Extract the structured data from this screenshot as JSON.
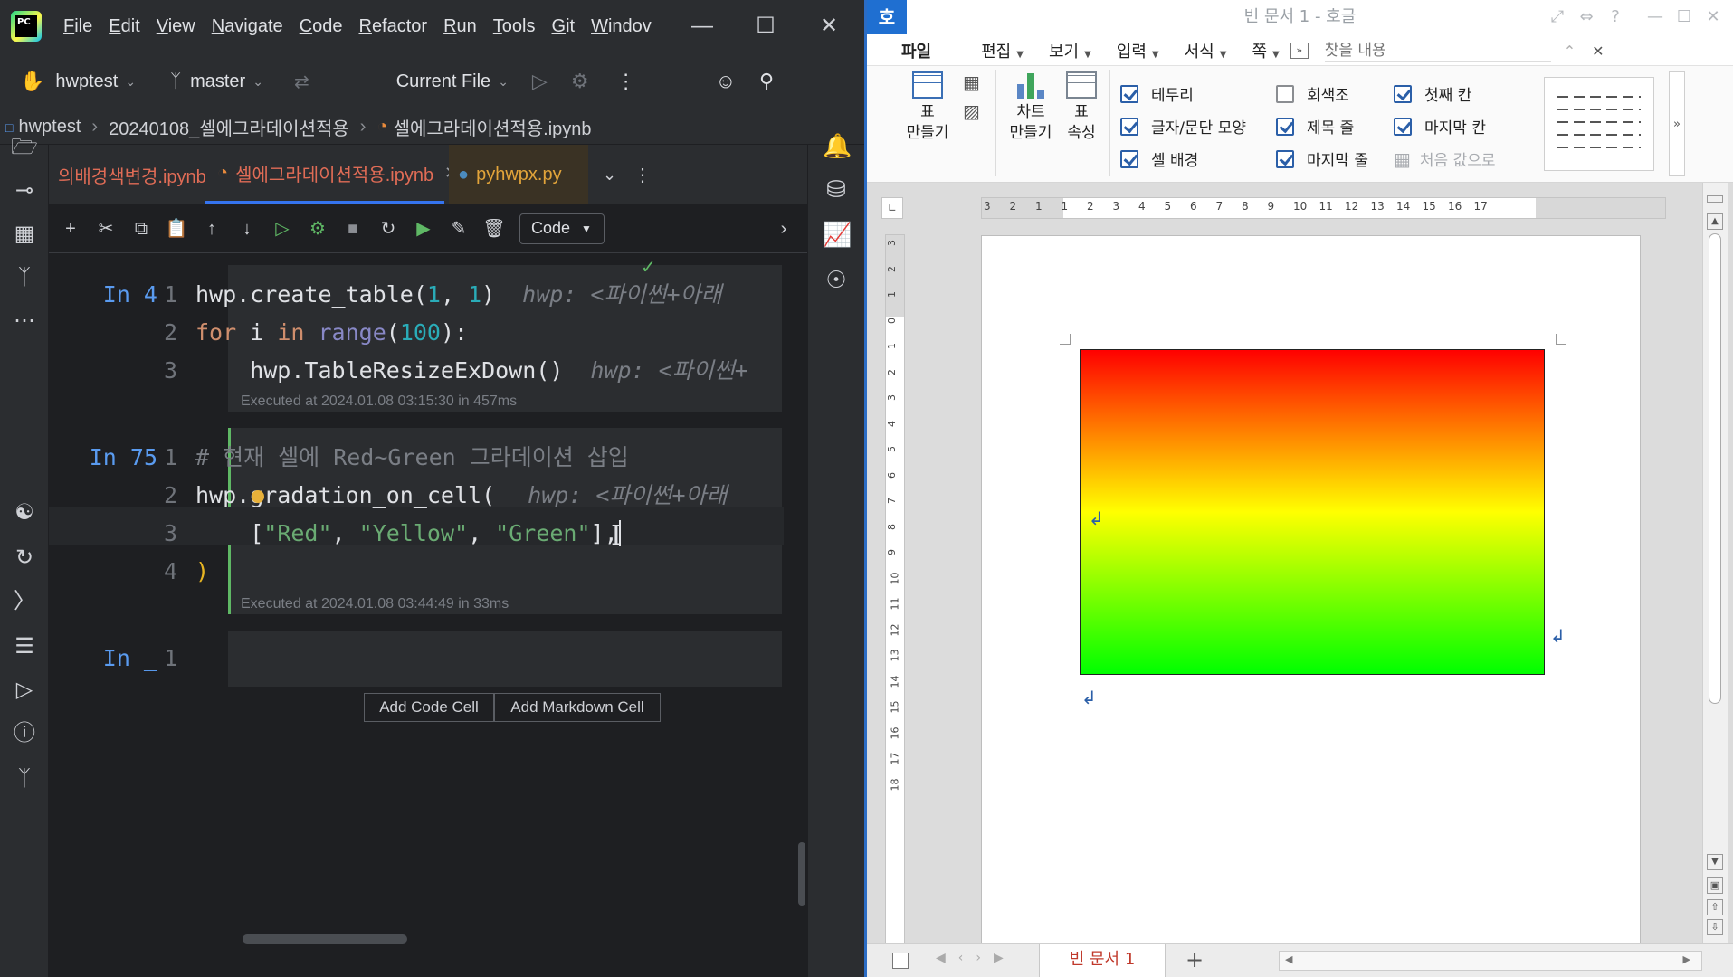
{
  "ide": {
    "menu": [
      {
        "label": "File",
        "mn": "F",
        "rest": "ile"
      },
      {
        "label": "Edit",
        "mn": "E",
        "rest": "dit"
      },
      {
        "label": "View",
        "mn": "V",
        "rest": "iew"
      },
      {
        "label": "Navigate",
        "mn": "N",
        "rest": "avigate"
      },
      {
        "label": "Code",
        "mn": "C",
        "rest": "ode"
      },
      {
        "label": "Refactor",
        "mn": "R",
        "rest": "efactor"
      },
      {
        "label": "Run",
        "mn": "R",
        "rest": "un"
      },
      {
        "label": "Tools",
        "mn": "T",
        "rest": "ools"
      },
      {
        "label": "Git",
        "mn": "G",
        "rest": "it"
      },
      {
        "label": "Window",
        "mn": "W",
        "rest": "indov"
      }
    ],
    "project": "hwptest",
    "branch": "master",
    "run_config": "Current File",
    "breadcrumb": [
      "hwptest",
      "20240108_셀에그라데이션적용",
      "셀에그라데이션적용.ipynb"
    ],
    "tabs": [
      {
        "label": "의배경색변경.ipynb"
      },
      {
        "label": "셀에그라데이션적용.ipynb",
        "active": true
      },
      {
        "label": "pyhwpx.py"
      }
    ],
    "cell_type": "Code",
    "cells": [
      {
        "prompt": "In 4",
        "lines": [
          "1",
          "2",
          "3"
        ],
        "code": {
          "l1a": "hwp.create_table(",
          "l1n1": "1",
          "l1c": ", ",
          "l1n2": "1",
          "l1b": ")",
          "l1hint": "hwp: <파이썬+아래",
          "l2kw": "for",
          "l2a": " i ",
          "l2in": "in",
          "l2b": " ",
          "l2rng": "range",
          "l2c": "(",
          "l2n": "100",
          "l2d": "):",
          "l3": "    hwp.TableResizeExDown()",
          "l3hint": "hwp: <파이썬+"
        },
        "executed": "Executed at 2024.01.08 03:15:30 in 457ms"
      },
      {
        "prompt": "In 75",
        "lines": [
          "1",
          "2",
          "3",
          "4"
        ],
        "code": {
          "l1": "# 현재 셀에 Red~Green 그라데이션 삽입",
          "l2": "hwp.gradation_on_cell(",
          "l2hint": "hwp: <파이썬+아래",
          "l3pre": "    [",
          "s1": "\"Red\"",
          "c1": ", ",
          "s2": "\"Yellow\"",
          "c2": ", ",
          "s3": "\"Green\"",
          "l3post": "],",
          "l4": ")"
        },
        "executed": "Executed at 2024.01.08 03:44:49 in 33ms"
      },
      {
        "prompt": "In _",
        "lines": [
          "1"
        ]
      }
    ],
    "add_code_cell": "Add Code Cell",
    "add_markdown_cell": "Add Markdown Cell",
    "colors": {
      "accent": "#3574f0",
      "keyword": "#cf8e6d",
      "string": "#6aab73",
      "number": "#2aacb8",
      "prompt": "#5a9bf0"
    }
  },
  "hwp": {
    "title": "빈 문서 1 - 호글",
    "logo": "호",
    "menu": [
      "파일",
      "편집",
      "보기",
      "입력",
      "서식",
      "쪽"
    ],
    "search_placeholder": "찾을 내용",
    "ribbon": {
      "table_make": "표\n만들기",
      "chart_make": "차트\n만들기",
      "table_props": "표\n속성",
      "checks": [
        {
          "label": "테두리",
          "checked": true
        },
        {
          "label": "글자/문단 모양",
          "checked": true
        },
        {
          "label": "셀 배경",
          "checked": true
        },
        {
          "label": "회색조",
          "checked": false
        },
        {
          "label": "제목 줄",
          "checked": true
        },
        {
          "label": "마지막 줄",
          "checked": true
        },
        {
          "label": "첫째 칸",
          "checked": true
        },
        {
          "label": "마지막 칸",
          "checked": true
        },
        {
          "label": "처음 값으로",
          "checked": false,
          "disabled": true
        }
      ]
    },
    "hruler_ticks": [
      "3",
      "2",
      "1",
      "1",
      "2",
      "3",
      "4",
      "5",
      "6",
      "7",
      "8",
      "9",
      "10",
      "11",
      "12",
      "13",
      "14",
      "15",
      "16",
      "17"
    ],
    "vruler_ticks": [
      "3",
      "2",
      "1",
      "0",
      "1",
      "2",
      "3",
      "4",
      "5",
      "6",
      "7",
      "8",
      "9",
      "10",
      "11",
      "12",
      "13",
      "14",
      "15",
      "16",
      "17",
      "18"
    ],
    "gradient": {
      "colors": [
        "#ff0000",
        "#ffff00",
        "#00ff00"
      ]
    },
    "doc_tab": "빈 문서 1",
    "add_tab": "+"
  }
}
